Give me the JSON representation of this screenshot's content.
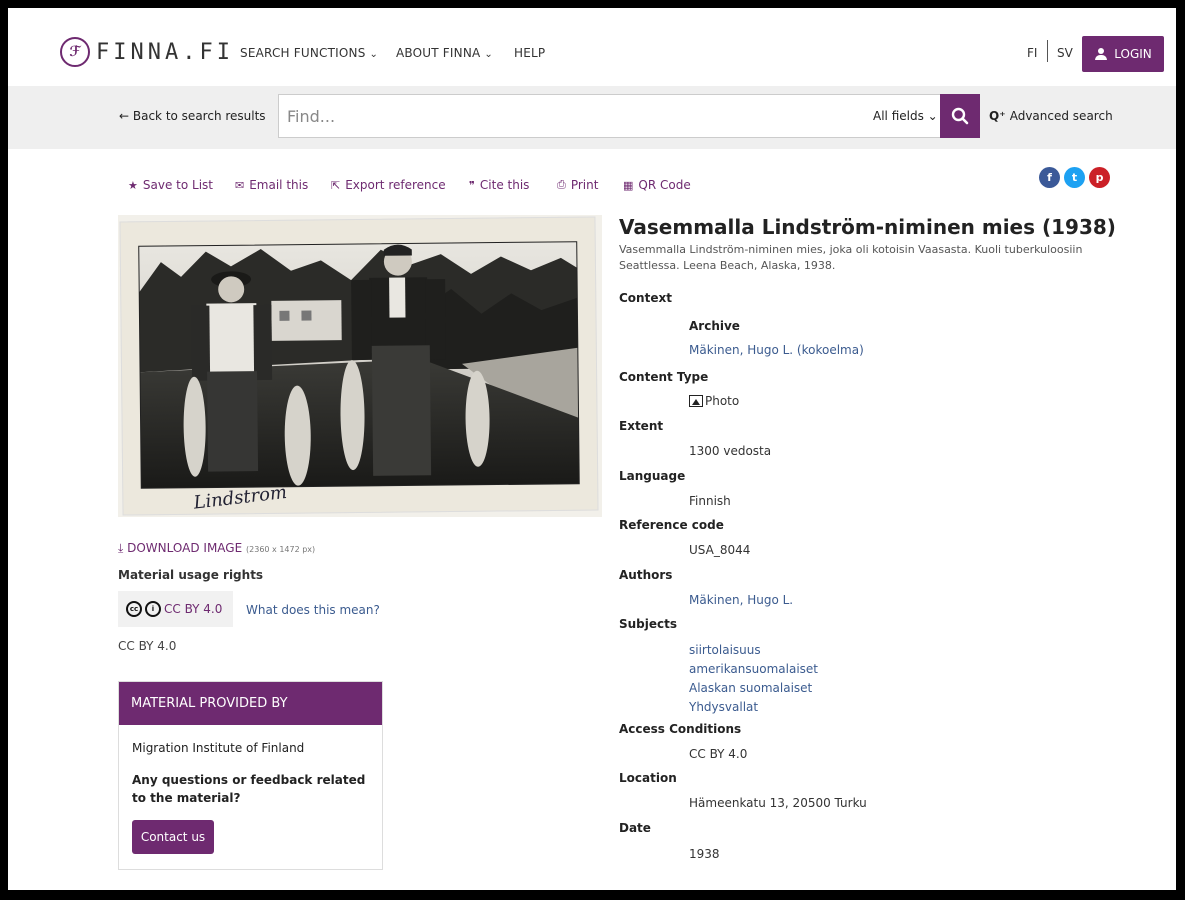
{
  "header": {
    "logo_text": "FINNA.FI",
    "nav": [
      {
        "label": "SEARCH FUNCTIONS"
      },
      {
        "label": "ABOUT FINNA"
      },
      {
        "label": "HELP"
      }
    ],
    "lang_fi": "FI",
    "lang_sv": "SV",
    "login_label": "LOGIN"
  },
  "search": {
    "back_label": "Back to search results",
    "placeholder": "Find...",
    "field_select": "All fields",
    "advanced_label": "Advanced search"
  },
  "toolbar": {
    "save": "Save to List",
    "email": "Email this",
    "export": "Export reference",
    "cite": "Cite this",
    "print": "Print",
    "qr": "QR Code"
  },
  "social": {
    "facebook": "f",
    "twitter": "t",
    "pinterest": "p"
  },
  "image": {
    "signature": "Lindstrom"
  },
  "download": {
    "label": "DOWNLOAD IMAGE",
    "size": "(2360 x 1472 px)"
  },
  "rights": {
    "title": "Material usage rights",
    "license": "CC BY 4.0",
    "what_means": "What does this mean?",
    "license_text": "CC BY 4.0"
  },
  "provider": {
    "heading": "MATERIAL PROVIDED BY",
    "name": "Migration Institute of Finland",
    "question": "Any questions or feedback related to the material?",
    "contact": "Contact us"
  },
  "record": {
    "title": "Vasemmalla Lindström-niminen mies (1938)",
    "description": "Vasemmalla Lindström-niminen mies, joka oli kotoisin Vaasasta. Kuoli tuberkuloosiin Seattlessa. Leena Beach, Alaska, 1938.",
    "context_label": "Context",
    "archive_label": "Archive",
    "archive_value": "Mäkinen, Hugo L. (kokoelma)",
    "content_type_label": "Content Type",
    "content_type_value": "Photo",
    "extent_label": "Extent",
    "extent_value": "1300 vedosta",
    "language_label": "Language",
    "language_value": "Finnish",
    "refcode_label": "Reference code",
    "refcode_value": "USA_8044",
    "authors_label": "Authors",
    "authors_value": "Mäkinen, Hugo L.",
    "subjects_label": "Subjects",
    "subjects": [
      "siirtolaisuus",
      "amerikansuomalaiset",
      "Alaskan suomalaiset",
      "Yhdysvallat"
    ],
    "access_label": "Access Conditions",
    "access_value": "CC BY 4.0",
    "location_label": "Location",
    "location_value": "Hämeenkatu 13, 20500 Turku",
    "date_label": "Date",
    "date_value": "1938"
  },
  "colors": {
    "brand": "#6e2a70",
    "link": "#3b5b8f"
  }
}
